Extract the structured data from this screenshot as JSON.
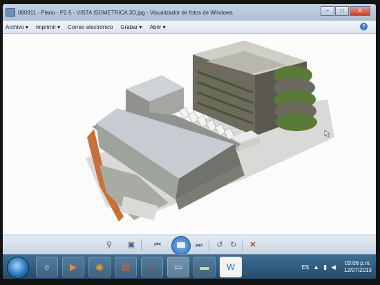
{
  "window": {
    "title": "080911 - Plano - P2-5 - VISTA ISOMETRICA 3D.jpg - Visualizador de fotos de Windows",
    "min_label": "–",
    "max_label": "□",
    "close_label": "X"
  },
  "menu": {
    "items": [
      "Archivo ▾",
      "Imprimir ▾",
      "Correo electrónico",
      "Grabar ▾",
      "Abrir ▾"
    ],
    "help_label": "?"
  },
  "toolbar": {
    "icons": [
      "zoom-icon",
      "actual-size-icon",
      "previous-icon",
      "slideshow-icon",
      "next-icon",
      "rotate-left-icon",
      "rotate-right-icon",
      "delete-icon"
    ]
  },
  "taskbar": {
    "apps": [
      "internet-explorer",
      "media-player",
      "firefox",
      "powerpoint-style-app",
      "acrobat-reader",
      "photo-viewer",
      "file-explorer",
      "word"
    ],
    "language": "ES",
    "time": "03:06 p.m.",
    "date": "12/07/2013"
  },
  "colors": {
    "titlebar": "#b5c6d9",
    "taskbar": "#2e5a7e",
    "roof": "#c8ccd2",
    "wall": "#8c9088",
    "terracotta": "#c8703a",
    "greenery": "#5a7a3a"
  }
}
